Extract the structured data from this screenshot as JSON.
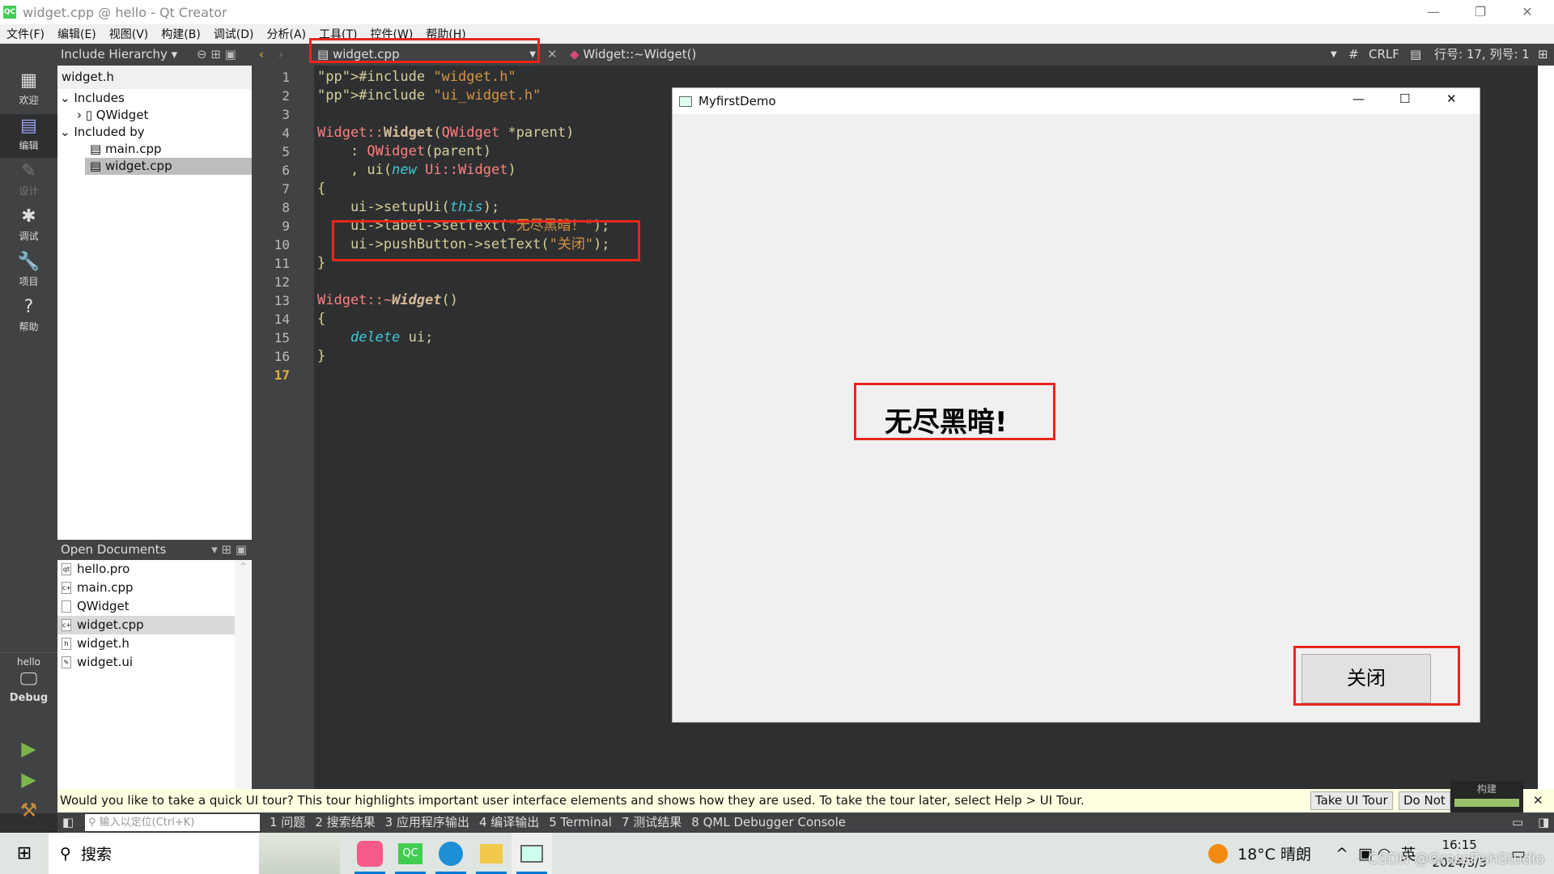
{
  "window": {
    "title": "widget.cpp @ hello - Qt Creator",
    "logo": "QC"
  },
  "menu": [
    "文件(F)",
    "编辑(E)",
    "视图(V)",
    "构建(B)",
    "调试(D)",
    "分析(A)",
    "工具(T)",
    "控件(W)",
    "帮助(H)"
  ],
  "toolbar": {
    "panel_title": "Include Hierarchy",
    "file_tab": "widget.cpp",
    "symbol": "Widget::~Widget()",
    "hash": "#",
    "line_ending": "CRLF",
    "position": "行号: 17, 列号: 1"
  },
  "modes": [
    {
      "label": "欢迎",
      "icon": "grid-icon"
    },
    {
      "label": "编辑",
      "icon": "edit-icon"
    },
    {
      "label": "设计",
      "icon": "pencil-icon"
    },
    {
      "label": "调试",
      "icon": "bug-icon"
    },
    {
      "label": "项目",
      "icon": "wrench-icon"
    },
    {
      "label": "帮助",
      "icon": "help-icon"
    }
  ],
  "kit": {
    "project": "hello",
    "config": "Debug"
  },
  "include_hierarchy": {
    "root": "widget.h",
    "includes_label": "Includes",
    "includes": [
      "QWidget"
    ],
    "included_by_label": "Included by",
    "included_by": [
      "main.cpp",
      "widget.cpp"
    ]
  },
  "open_documents": {
    "title": "Open Documents",
    "items": [
      "hello.pro",
      "main.cpp",
      "QWidget",
      "widget.cpp",
      "widget.h",
      "widget.ui"
    ],
    "selected": "widget.cpp"
  },
  "code": {
    "current_line": 17,
    "lines": [
      "#include \"widget.h\"",
      "#include \"ui_widget.h\"",
      "",
      "Widget::Widget(QWidget *parent)",
      "    : QWidget(parent)",
      "    , ui(new Ui::Widget)",
      "{",
      "    ui->setupUi(this);",
      "    ui->label->setText(\"无尽黑暗！\");",
      "    ui->pushButton->setText(\"关闭\");",
      "}",
      "",
      "Widget::~Widget()",
      "{",
      "    delete ui;",
      "}",
      ""
    ]
  },
  "demo": {
    "title": "MyfirstDemo",
    "label": "无尽黑暗!",
    "button": "关闭"
  },
  "tour": {
    "message": "Would you like to take a quick UI tour? This tour highlights important user interface elements and shows how they are used. To take the tour later, select Help > UI Tour.",
    "take": "Take UI Tour",
    "dont": "Do Not",
    "build_label": "构建",
    "build_progress": 1.0
  },
  "output_panes": {
    "locator_placeholder": "输入以定位(Ctrl+K)",
    "tabs": [
      "1 问题",
      "2 搜索结果",
      "3 应用程序输出",
      "4 编译输出",
      "5 Terminal",
      "7 测试结果",
      "8 QML Debugger Console"
    ]
  },
  "taskbar": {
    "search": "搜索",
    "weather": "18°C 晴朗",
    "ime": "英",
    "time": "16:15",
    "date": "2024/3/3",
    "watermark": "CSDN @GrassFishStudio"
  },
  "colors": {
    "highlight": "#e8261c",
    "dark_panel": "#404244",
    "editor_bg": "#2e2f30",
    "build_bar": "#99c26c"
  }
}
